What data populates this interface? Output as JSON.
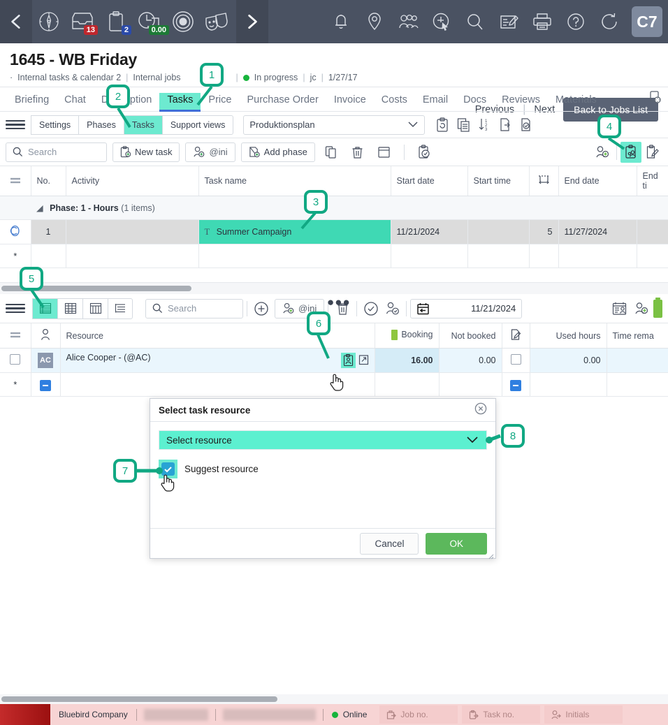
{
  "appbar": {
    "left_icons": [
      "back-arrow-icon",
      "compass-icon",
      "inbox-icon",
      "clipboard-icon",
      "time-clock-icon",
      "record-icon",
      "masks-icon",
      "forward-arrow-icon"
    ],
    "badges": {
      "inbox": "13",
      "clipboard": "2",
      "time": "0.00"
    },
    "right_icons": [
      "bell-icon",
      "location-pin-icon",
      "people-icon",
      "add-cursor-icon",
      "search-icon",
      "edit-note-icon",
      "printer-icon",
      "help-icon",
      "refresh-icon"
    ],
    "user_initials": "C7"
  },
  "job": {
    "title": "1645 - WB Friday",
    "bullet": "·",
    "breadcrumb_1": "Internal tasks & calendar 2",
    "breadcrumb_2": "Internal jobs",
    "status": "In progress",
    "owner": "jc",
    "date": "1/27/17",
    "previous": "Previous",
    "next": "Next",
    "back_button": "Back to Jobs List"
  },
  "main_tabs": [
    {
      "label": "Briefing",
      "active": false
    },
    {
      "label": "Chat",
      "active": false
    },
    {
      "label": "Description",
      "active": false
    },
    {
      "label": "Tasks",
      "active": true
    },
    {
      "label": "Price",
      "active": false
    },
    {
      "label": "Purchase Order",
      "active": false
    },
    {
      "label": "Invoice",
      "active": false
    },
    {
      "label": "Costs",
      "active": false
    },
    {
      "label": "Email",
      "active": false
    },
    {
      "label": "Docs",
      "active": false
    },
    {
      "label": "Reviews",
      "active": false
    },
    {
      "label": "Materials",
      "active": false
    }
  ],
  "subbar": {
    "tabs": [
      {
        "label": "Settings",
        "active": false
      },
      {
        "label": "Phases",
        "active": false
      },
      {
        "label": "Tasks",
        "active": true
      },
      {
        "label": "Support views",
        "active": false
      }
    ],
    "plan_select": "Produktionsplan",
    "icons": [
      "clipboard-refresh-icon",
      "copy-rows-icon",
      "sort-123-icon",
      "export-icon",
      "checklist-approve-icon"
    ]
  },
  "tasks_toolbar": {
    "search_placeholder": "Search",
    "new_task": "New task",
    "assignee": "@ini",
    "add_phase": "Add phase",
    "icons": [
      "copy-icon",
      "delete-icon",
      "calendar-icon",
      "approve-task-icon",
      "add-person-icon",
      "assign-resource-icon",
      "edit-clipboard-icon"
    ]
  },
  "tasks_grid": {
    "columns": [
      "No.",
      "Activity",
      "Task name",
      "Start date",
      "Start time",
      "duration-icon",
      "End date",
      "End ti"
    ],
    "phase_label": "Phase: 1 - Hours",
    "phase_count": "(1 items)",
    "rows": [
      {
        "no": "1",
        "activity": "",
        "task_name": "Summer Campaign",
        "start_date": "11/21/2024",
        "start_time": "",
        "duration": "5",
        "end_date": "11/27/2024",
        "end_time": ""
      }
    ],
    "new_row_marker": "*"
  },
  "resource_toolbar": {
    "view_icons": [
      "list-view-icon",
      "grid-view-icon",
      "gantt-view-icon",
      "outline-view-icon"
    ],
    "search_placeholder": "Search",
    "add": "add-icon",
    "assignee": "@ini",
    "icons": [
      "delete-icon",
      "approve-icon",
      "approve-person-icon",
      "resource-report-icon",
      "add-person-icon",
      "battery-icon"
    ],
    "date_value": "11/21/2024"
  },
  "resource_grid": {
    "columns": [
      "person-icon",
      "Resource",
      "Booking",
      "Not booked",
      "note-icon",
      "Used hours",
      "Time rema"
    ],
    "rows": [
      {
        "initials": "AC",
        "resource": "Alice Cooper - (@AC)",
        "booking": "16.00",
        "not_booked": "0.00",
        "used_hours": "0.00",
        "time_remaining": ""
      }
    ],
    "new_row_marker": "*"
  },
  "modal": {
    "title": "Select task resource",
    "select_placeholder": "Select resource",
    "checkbox_label": "Suggest resource",
    "cancel": "Cancel",
    "ok": "OK"
  },
  "callouts": [
    {
      "num": "1"
    },
    {
      "num": "2"
    },
    {
      "num": "3"
    },
    {
      "num": "4"
    },
    {
      "num": "5"
    },
    {
      "num": "6"
    },
    {
      "num": "7"
    },
    {
      "num": "8"
    }
  ],
  "statusbar": {
    "company": "Bluebird Company",
    "online": "Online",
    "job_no": "Job no.",
    "task_no": "Task no.",
    "initials": "Initials"
  },
  "colors": {
    "appbar_bg": "#4a5262",
    "highlight": "#6dead0",
    "selection": "#3fd9b4",
    "callout": "#11a883",
    "ok_green": "#5cb85c",
    "status_green": "#18b43c",
    "badge_red": "#c0272d",
    "badge_blue": "#2b4aa8",
    "badge_green": "#1d7a36",
    "statusbar_bg": "#f7d4d4"
  }
}
